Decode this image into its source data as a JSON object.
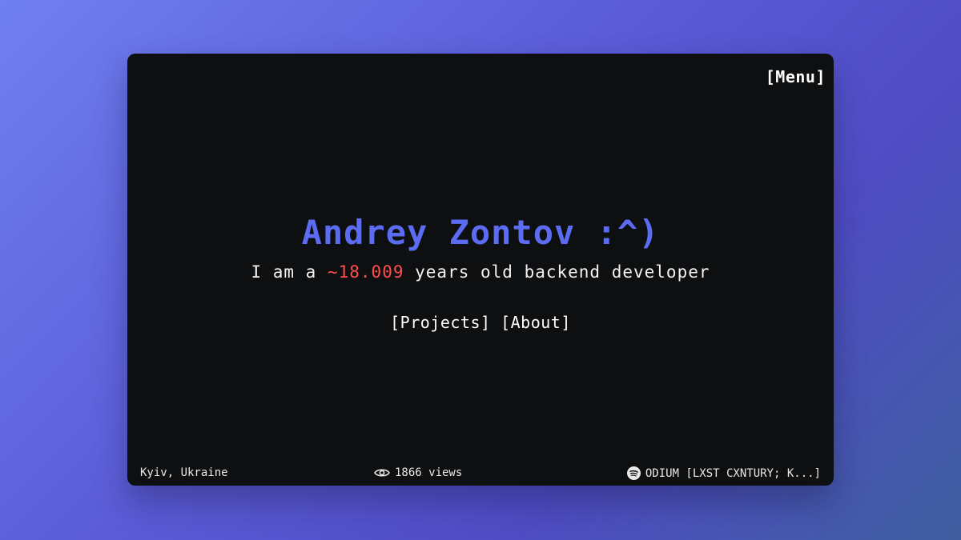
{
  "header": {
    "menu_label": "[Menu]"
  },
  "hero": {
    "name": "Andrey Zontov :^)",
    "tagline_prefix": "I am a ",
    "age": "~18.009",
    "tagline_suffix": " years old backend developer"
  },
  "nav": {
    "projects_label": "[Projects]",
    "about_label": "[About]"
  },
  "footer": {
    "location": "Kyiv, Ukraine",
    "views_icon": "eye-icon",
    "views": "1866 views",
    "music_icon": "spotify-icon",
    "now_playing": "ODIUM [LXST CXNTURY; K...]"
  },
  "colors": {
    "name": "#5c6cf2",
    "age": "#ff4d4d",
    "window_bg": "#0d0f11"
  }
}
